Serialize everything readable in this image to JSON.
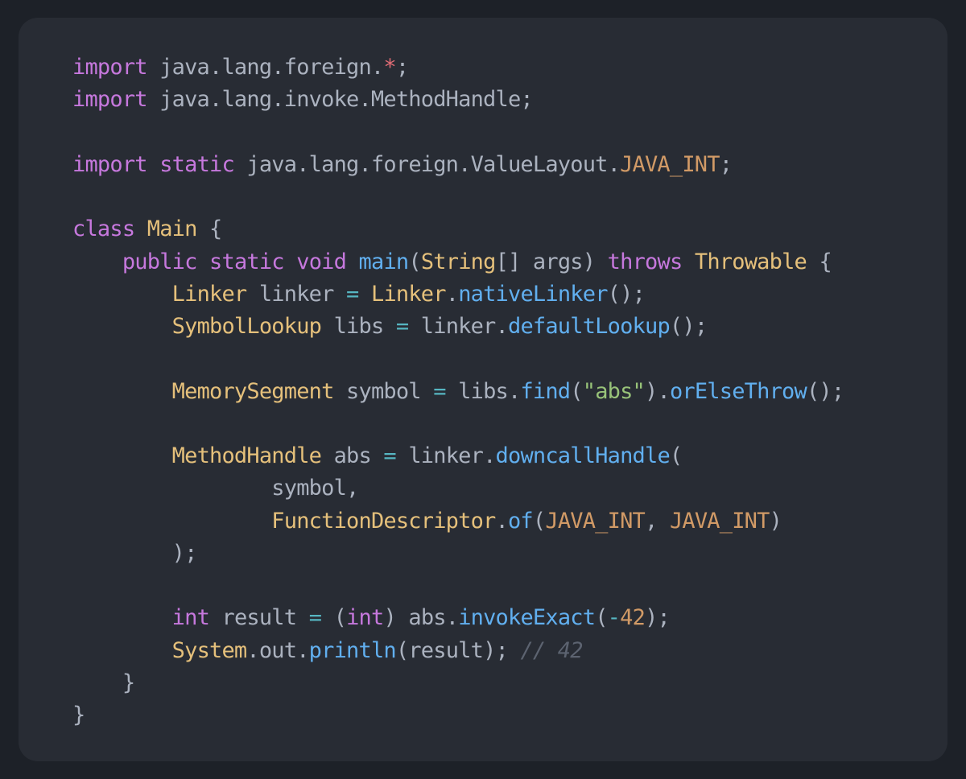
{
  "colors": {
    "page_background": "#1d2128",
    "card_background": "#282c34",
    "plain": "#abb2bf",
    "keyword": "#c678dd",
    "type": "#e5c07b",
    "function": "#61afef",
    "string": "#98c379",
    "constant": "#d19a66",
    "number": "#d19a66",
    "operator": "#56b6c2",
    "star": "#e06c75",
    "comment": "#5c6370"
  },
  "code": {
    "language": "java",
    "lines": [
      [
        [
          "keyword",
          "import"
        ],
        [
          "plain",
          " java.lang.foreign."
        ],
        [
          "star",
          "*"
        ],
        [
          "plain",
          ";"
        ]
      ],
      [
        [
          "keyword",
          "import"
        ],
        [
          "plain",
          " java.lang.invoke.MethodHandle;"
        ]
      ],
      [],
      [
        [
          "keyword",
          "import"
        ],
        [
          "plain",
          " "
        ],
        [
          "keyword",
          "static"
        ],
        [
          "plain",
          " java.lang.foreign.ValueLayout."
        ],
        [
          "constant",
          "JAVA_INT"
        ],
        [
          "plain",
          ";"
        ]
      ],
      [],
      [
        [
          "keyword",
          "class"
        ],
        [
          "plain",
          " "
        ],
        [
          "type",
          "Main"
        ],
        [
          "plain",
          " {"
        ]
      ],
      [
        [
          "plain",
          "    "
        ],
        [
          "keyword",
          "public"
        ],
        [
          "plain",
          " "
        ],
        [
          "keyword",
          "static"
        ],
        [
          "plain",
          " "
        ],
        [
          "keyword",
          "void"
        ],
        [
          "plain",
          " "
        ],
        [
          "function",
          "main"
        ],
        [
          "plain",
          "("
        ],
        [
          "type",
          "String"
        ],
        [
          "plain",
          "[] args) "
        ],
        [
          "keyword",
          "throws"
        ],
        [
          "plain",
          " "
        ],
        [
          "type",
          "Throwable"
        ],
        [
          "plain",
          " {"
        ]
      ],
      [
        [
          "plain",
          "        "
        ],
        [
          "type",
          "Linker"
        ],
        [
          "plain",
          " linker "
        ],
        [
          "operator",
          "="
        ],
        [
          "plain",
          " "
        ],
        [
          "type",
          "Linker"
        ],
        [
          "plain",
          "."
        ],
        [
          "function",
          "nativeLinker"
        ],
        [
          "plain",
          "();"
        ]
      ],
      [
        [
          "plain",
          "        "
        ],
        [
          "type",
          "SymbolLookup"
        ],
        [
          "plain",
          " libs "
        ],
        [
          "operator",
          "="
        ],
        [
          "plain",
          " linker."
        ],
        [
          "function",
          "defaultLookup"
        ],
        [
          "plain",
          "();"
        ]
      ],
      [],
      [
        [
          "plain",
          "        "
        ],
        [
          "type",
          "MemorySegment"
        ],
        [
          "plain",
          " symbol "
        ],
        [
          "operator",
          "="
        ],
        [
          "plain",
          " libs."
        ],
        [
          "function",
          "find"
        ],
        [
          "plain",
          "("
        ],
        [
          "string",
          "\"abs\""
        ],
        [
          "plain",
          ")."
        ],
        [
          "function",
          "orElseThrow"
        ],
        [
          "plain",
          "();"
        ]
      ],
      [],
      [
        [
          "plain",
          "        "
        ],
        [
          "type",
          "MethodHandle"
        ],
        [
          "plain",
          " abs "
        ],
        [
          "operator",
          "="
        ],
        [
          "plain",
          " linker."
        ],
        [
          "function",
          "downcallHandle"
        ],
        [
          "plain",
          "("
        ]
      ],
      [
        [
          "plain",
          "                symbol,"
        ]
      ],
      [
        [
          "plain",
          "                "
        ],
        [
          "type",
          "FunctionDescriptor"
        ],
        [
          "plain",
          "."
        ],
        [
          "function",
          "of"
        ],
        [
          "plain",
          "("
        ],
        [
          "constant",
          "JAVA_INT"
        ],
        [
          "plain",
          ", "
        ],
        [
          "constant",
          "JAVA_INT"
        ],
        [
          "plain",
          ")"
        ]
      ],
      [
        [
          "plain",
          "        );"
        ]
      ],
      [],
      [
        [
          "plain",
          "        "
        ],
        [
          "keyword",
          "int"
        ],
        [
          "plain",
          " result "
        ],
        [
          "operator",
          "="
        ],
        [
          "plain",
          " ("
        ],
        [
          "keyword",
          "int"
        ],
        [
          "plain",
          ") abs."
        ],
        [
          "function",
          "invokeExact"
        ],
        [
          "plain",
          "("
        ],
        [
          "operator",
          "-"
        ],
        [
          "number",
          "42"
        ],
        [
          "plain",
          ");"
        ]
      ],
      [
        [
          "plain",
          "        "
        ],
        [
          "type",
          "System"
        ],
        [
          "plain",
          ".out."
        ],
        [
          "function",
          "println"
        ],
        [
          "plain",
          "(result); "
        ],
        [
          "comment",
          "// 42"
        ]
      ],
      [
        [
          "plain",
          "    }"
        ]
      ],
      [
        [
          "plain",
          "}"
        ]
      ]
    ]
  }
}
